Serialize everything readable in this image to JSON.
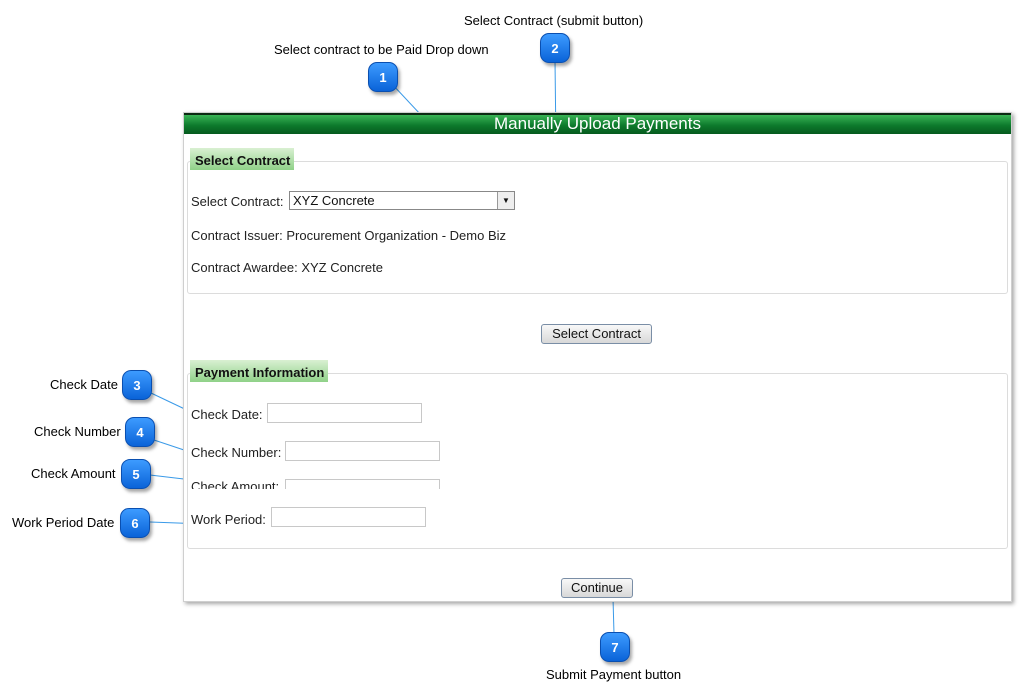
{
  "callouts": {
    "c1": {
      "number": "1",
      "text": "Select contract to be Paid Drop down"
    },
    "c2": {
      "number": "2",
      "text": "Select Contract (submit button)"
    },
    "c3": {
      "number": "3",
      "text": "Check Date"
    },
    "c4": {
      "number": "4",
      "text": "Check Number"
    },
    "c5": {
      "number": "5",
      "text": "Check Amount"
    },
    "c6": {
      "number": "6",
      "text": "Work Period Date"
    },
    "c7": {
      "number": "7",
      "text": "Submit Payment button"
    }
  },
  "panel": {
    "title": "Manually Upload Payments",
    "select_contract": {
      "legend": "Select Contract",
      "contract_label": "Select Contract:",
      "contract_value": "XYZ Concrete",
      "issuer": "Contract Issuer: Procurement Organization - Demo Biz",
      "awardee": "Contract Awardee: XYZ Concrete",
      "button": "Select Contract"
    },
    "payment": {
      "legend": "Payment Information",
      "check_date_label": "Check Date:",
      "check_number_label": "Check Number:",
      "check_amount_label": "Check Amount:",
      "work_period_label": "Work Period:",
      "continue_button": "Continue"
    }
  },
  "colors": {
    "header_green": "#0d7a2c",
    "badge_blue": "#1a7cf0",
    "legend_green": "#8fd188"
  }
}
